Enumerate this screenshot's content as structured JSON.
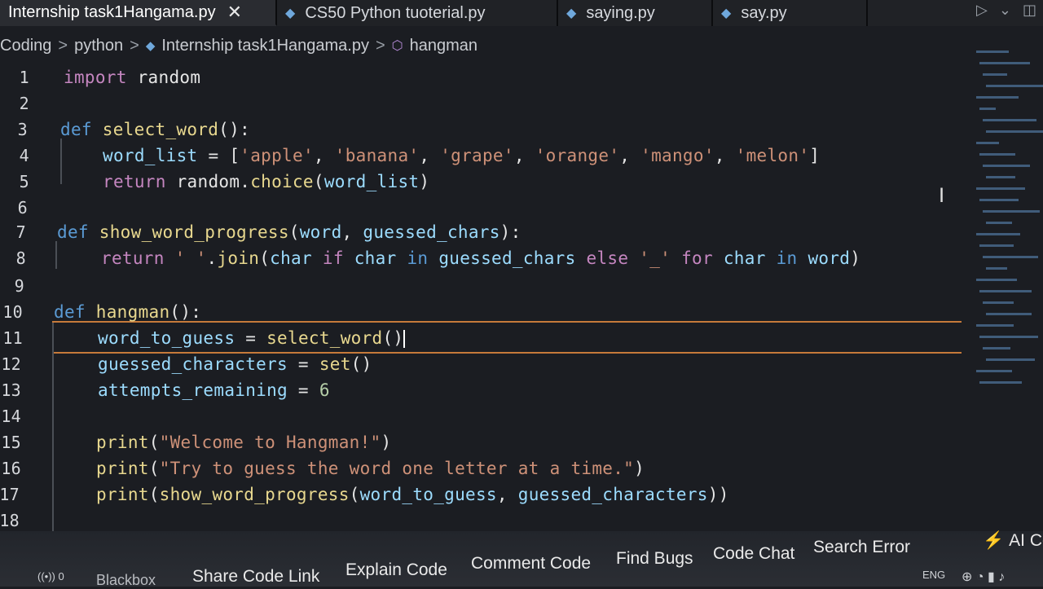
{
  "tabs": [
    {
      "label": "Internship task1Hangama.py",
      "active": true
    },
    {
      "label": "CS50 Python tuoterial.py",
      "active": false
    },
    {
      "label": "saying.py",
      "active": false
    },
    {
      "label": "say.py",
      "active": false
    }
  ],
  "breadcrumb": {
    "items": [
      "Coding",
      "python",
      "Internship task1Hangama.py",
      "hangman"
    ]
  },
  "code_lines": [
    {
      "num": "1",
      "tokens": [
        {
          "t": "import",
          "c": "kw2"
        },
        {
          "t": " random",
          "c": "plain"
        }
      ]
    },
    {
      "num": "2",
      "tokens": []
    },
    {
      "num": "3",
      "tokens": [
        {
          "t": "def",
          "c": "kw"
        },
        {
          "t": " ",
          "c": "plain"
        },
        {
          "t": "select_word",
          "c": "fn"
        },
        {
          "t": "():",
          "c": "plain"
        }
      ]
    },
    {
      "num": "4",
      "tokens": [
        {
          "t": "word_list",
          "c": "var"
        },
        {
          "t": " = [",
          "c": "plain"
        },
        {
          "t": "'apple'",
          "c": "str"
        },
        {
          "t": ", ",
          "c": "plain"
        },
        {
          "t": "'banana'",
          "c": "str"
        },
        {
          "t": ", ",
          "c": "plain"
        },
        {
          "t": "'grape'",
          "c": "str"
        },
        {
          "t": ", ",
          "c": "plain"
        },
        {
          "t": "'orange'",
          "c": "str"
        },
        {
          "t": ", ",
          "c": "plain"
        },
        {
          "t": "'mango'",
          "c": "str"
        },
        {
          "t": ", ",
          "c": "plain"
        },
        {
          "t": "'melon'",
          "c": "str"
        },
        {
          "t": "]",
          "c": "plain"
        }
      ]
    },
    {
      "num": "5",
      "tokens": [
        {
          "t": "return",
          "c": "kw2"
        },
        {
          "t": " random.",
          "c": "plain"
        },
        {
          "t": "choice",
          "c": "fn"
        },
        {
          "t": "(",
          "c": "plain"
        },
        {
          "t": "word_list",
          "c": "var"
        },
        {
          "t": ")",
          "c": "plain"
        }
      ]
    },
    {
      "num": "6",
      "tokens": []
    },
    {
      "num": "7",
      "tokens": [
        {
          "t": "def",
          "c": "kw"
        },
        {
          "t": " ",
          "c": "plain"
        },
        {
          "t": "show_word_progress",
          "c": "fn"
        },
        {
          "t": "(",
          "c": "plain"
        },
        {
          "t": "word",
          "c": "var"
        },
        {
          "t": ", ",
          "c": "plain"
        },
        {
          "t": "guessed_chars",
          "c": "var"
        },
        {
          "t": "):",
          "c": "plain"
        }
      ]
    },
    {
      "num": "8",
      "tokens": [
        {
          "t": "return",
          "c": "kw2"
        },
        {
          "t": " ",
          "c": "plain"
        },
        {
          "t": "' '",
          "c": "str"
        },
        {
          "t": ".",
          "c": "plain"
        },
        {
          "t": "join",
          "c": "fn"
        },
        {
          "t": "(",
          "c": "plain"
        },
        {
          "t": "char",
          "c": "var"
        },
        {
          "t": " ",
          "c": "plain"
        },
        {
          "t": "if",
          "c": "kw2"
        },
        {
          "t": " ",
          "c": "plain"
        },
        {
          "t": "char",
          "c": "var"
        },
        {
          "t": " ",
          "c": "plain"
        },
        {
          "t": "in",
          "c": "kw"
        },
        {
          "t": " ",
          "c": "plain"
        },
        {
          "t": "guessed_chars",
          "c": "var"
        },
        {
          "t": " ",
          "c": "plain"
        },
        {
          "t": "else",
          "c": "kw2"
        },
        {
          "t": " ",
          "c": "plain"
        },
        {
          "t": "'_'",
          "c": "str"
        },
        {
          "t": " ",
          "c": "plain"
        },
        {
          "t": "for",
          "c": "kw2"
        },
        {
          "t": " ",
          "c": "plain"
        },
        {
          "t": "char",
          "c": "var"
        },
        {
          "t": " ",
          "c": "plain"
        },
        {
          "t": "in",
          "c": "kw"
        },
        {
          "t": " ",
          "c": "plain"
        },
        {
          "t": "word",
          "c": "var"
        },
        {
          "t": ")",
          "c": "plain"
        }
      ]
    },
    {
      "num": "9",
      "tokens": []
    },
    {
      "num": "10",
      "tokens": [
        {
          "t": "def",
          "c": "kw"
        },
        {
          "t": " ",
          "c": "plain"
        },
        {
          "t": "hangman",
          "c": "fn"
        },
        {
          "t": "():",
          "c": "plain"
        }
      ]
    },
    {
      "num": "11",
      "tokens": [
        {
          "t": "word_to_guess",
          "c": "var"
        },
        {
          "t": " = ",
          "c": "plain"
        },
        {
          "t": "select_word",
          "c": "fn"
        },
        {
          "t": "()",
          "c": "plain"
        }
      ]
    },
    {
      "num": "12",
      "tokens": [
        {
          "t": "guessed_characters",
          "c": "var"
        },
        {
          "t": " = ",
          "c": "plain"
        },
        {
          "t": "set",
          "c": "fn"
        },
        {
          "t": "()",
          "c": "plain"
        }
      ]
    },
    {
      "num": "13",
      "tokens": [
        {
          "t": "attempts_remaining",
          "c": "var"
        },
        {
          "t": " = ",
          "c": "plain"
        },
        {
          "t": "6",
          "c": "num"
        }
      ]
    },
    {
      "num": "14",
      "tokens": []
    },
    {
      "num": "15",
      "tokens": [
        {
          "t": "print",
          "c": "fn"
        },
        {
          "t": "(",
          "c": "plain"
        },
        {
          "t": "\"Welcome to Hangman!\"",
          "c": "str"
        },
        {
          "t": ")",
          "c": "plain"
        }
      ]
    },
    {
      "num": "16",
      "tokens": [
        {
          "t": "print",
          "c": "fn"
        },
        {
          "t": "(",
          "c": "plain"
        },
        {
          "t": "\"Try to guess the word one letter at a time.\"",
          "c": "str"
        },
        {
          "t": ")",
          "c": "plain"
        }
      ]
    },
    {
      "num": "17",
      "tokens": [
        {
          "t": "print",
          "c": "fn"
        },
        {
          "t": "(",
          "c": "plain"
        },
        {
          "t": "show_word_progress",
          "c": "fn"
        },
        {
          "t": "(",
          "c": "plain"
        },
        {
          "t": "word_to_guess",
          "c": "var"
        },
        {
          "t": ", ",
          "c": "plain"
        },
        {
          "t": "guessed_characters",
          "c": "var"
        },
        {
          "t": "))",
          "c": "plain"
        }
      ]
    },
    {
      "num": "18",
      "tokens": []
    }
  ],
  "toolbar": {
    "items": [
      "Blackbox",
      "Share Code Link",
      "Explain Code",
      "Comment Code",
      "Find Bugs",
      "Code Chat",
      "Search Error",
      "AI Co"
    ]
  },
  "tray": {
    "lang": "ENG",
    "errors": "0"
  },
  "colors": {
    "keyword": "#5b9bd5",
    "control": "#c586c0",
    "function": "#e8d88f",
    "variable": "#9cdcfe",
    "string": "#ce9178",
    "number": "#b5cea8",
    "highlight": "#c67a3a"
  }
}
